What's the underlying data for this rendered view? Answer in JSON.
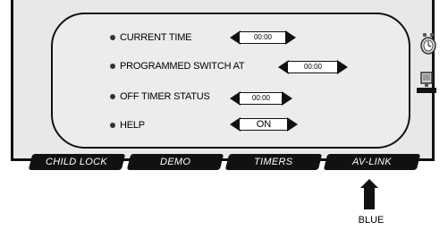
{
  "settings": {
    "rows": [
      {
        "label": "CURRENT TIME",
        "value": "00:00"
      },
      {
        "label": "PROGRAMMED SWITCH AT",
        "value": "00:00"
      },
      {
        "label": "OFF TIMER STATUS",
        "value": "00:00"
      },
      {
        "label": "HELP",
        "value": "ON"
      }
    ]
  },
  "tabs": [
    {
      "label": "CHILD LOCK"
    },
    {
      "label": "DEMO"
    },
    {
      "label": "TIMERS"
    },
    {
      "label": "AV-LINK"
    }
  ],
  "pointer": {
    "label": "BLUE"
  },
  "icons": {
    "clock": "alarm-clock-icon",
    "device": "tv-device-icon",
    "pointer": "pointer-arrow-icon"
  },
  "colors": {
    "panel_bg": "#ececec",
    "tab_bg": "#111111",
    "tab_text": "#ffffff"
  }
}
